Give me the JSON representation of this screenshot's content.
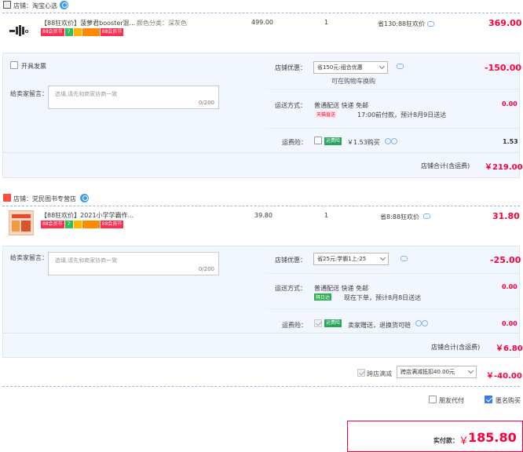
{
  "store1": {
    "label": "店铺：",
    "name": "淘宝心选",
    "product": {
      "title": "【88狂欢价】菠萝君booster混...",
      "spec": "颜色分类：深灰色",
      "price": "499.00",
      "qty": "1",
      "saving": "省130:88狂欢价",
      "subtotal": "369.00",
      "tags": [
        "88会员节",
        "7",
        "",
        "",
        "88会员节"
      ]
    },
    "invoice_label": "开具发票",
    "message_label": "给卖家留言：",
    "message_placeholder": "选填,请先和商家协商一致",
    "message_count": "0/200",
    "discount_label": "店铺优惠：",
    "discount_select": "省150元:组合优惠",
    "discount_note": "可在购物车换购",
    "discount_value": "-150.00",
    "shipping_label": "运送方式：",
    "shipping_method": "普通配送 快递 免邮",
    "delivery_badge": "天猫直送",
    "delivery_text": "17:00前付款，预计8月9日送达",
    "shipping_value": "0.00",
    "insurance_label": "运费险：",
    "insurance_badge": "运费险",
    "insurance_text": "￥1.53购买",
    "insurance_value": "1.53",
    "total_label": "店铺合计(含运费)",
    "total_value": "￥219.00"
  },
  "store2": {
    "label": "店铺：",
    "name": "党民图书专营店",
    "product": {
      "title": "【88狂欢价】2021小学学霸作...",
      "price": "39.80",
      "qty": "1",
      "saving": "省8:88狂欢价",
      "subtotal": "31.80",
      "tags": [
        "88会员节",
        "7",
        "",
        "",
        "88会员节"
      ]
    },
    "message_label": "给卖家留言：",
    "message_placeholder": "选填,请先和商家协商一致",
    "message_count": "0/200",
    "discount_label": "店铺优惠：",
    "discount_select": "省25元:学霸1上-25",
    "discount_value": "-25.00",
    "shipping_label": "运送方式：",
    "shipping_method": "普通配送 快递 免邮",
    "delivery_badge": "隔日达",
    "delivery_text": "现在下单，预计8月8日送达",
    "shipping_value": "0.00",
    "insurance_label": "运费险：",
    "insurance_badge": "运费险",
    "insurance_text": "卖家赠送，退换货可赔",
    "insurance_value": "0.00",
    "total_label": "店铺合计(含运费)",
    "total_value": "￥6.80"
  },
  "crossstore": {
    "label": "跨店满减",
    "select": "跨店满减抵扣40.00元",
    "value": "￥-40.00"
  },
  "options": {
    "friend_pay": "朋友代付",
    "anonymous": "匿名购买"
  },
  "pay": {
    "label": "实付款：",
    "currency": "￥",
    "amount": "185.80"
  },
  "colors": {
    "accent": "#ff0036",
    "band": "#f2f7ff",
    "link": "#3d7de8"
  }
}
